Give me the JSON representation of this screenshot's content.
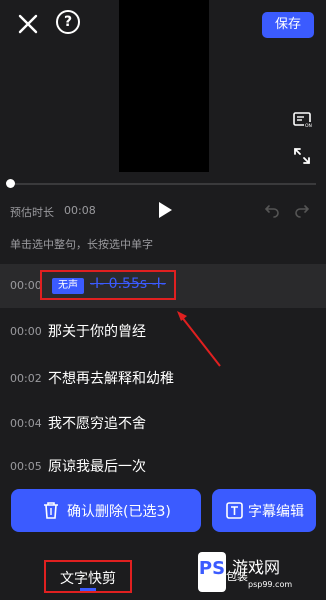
{
  "header": {
    "save_label": "保存",
    "help_label": "?"
  },
  "player": {
    "duration_label": "预估时长",
    "duration_value": "00:08",
    "progress_fraction": 0.01
  },
  "hint": "单击选中整句，长按选中单字",
  "rows": [
    {
      "time": "00:00",
      "badge": "无声",
      "text": "-I- 0.55s -I-",
      "selected": true
    },
    {
      "time": "00:00",
      "text": "那关于你的曾经"
    },
    {
      "time": "00:02",
      "text": "不想再去解释和幼稚"
    },
    {
      "time": "00:04",
      "text": "我不愿穷追不舍"
    },
    {
      "time": "00:05",
      "text": "原谅我最后一次"
    }
  ],
  "actions": {
    "confirm_delete": "确认删除(已选3)",
    "subtitle_edit": "字幕编辑"
  },
  "bottom_tab": "文字快剪",
  "watermark": {
    "brand": "游戏网",
    "url": "psp99.com",
    "logo": "PS",
    "extra": "包装"
  },
  "colors": {
    "accent": "#3b5bff",
    "highlight": "#e02020",
    "background": "#1c1c1e"
  }
}
